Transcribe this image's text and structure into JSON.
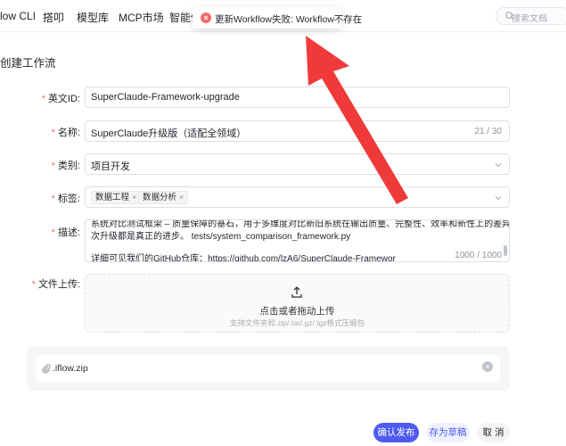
{
  "nav": {
    "items": [
      "low CLI",
      "搭叩",
      "模型库",
      "MCP市场",
      "智能体"
    ],
    "search_placeholder": "搜索文档"
  },
  "toast": {
    "message": "更新Workflow失败: Workflow不存在",
    "icon": "error-circle-icon",
    "color": "#f56c6c"
  },
  "page": {
    "title": "创建工作流"
  },
  "form": {
    "english_id": {
      "label": "英文ID:",
      "value": "SuperClaude-Framework-upgrade"
    },
    "name": {
      "label": "名称:",
      "value": "SuperClaude升级版（适配全领域）",
      "count": "21 / 30"
    },
    "category": {
      "label": "类别:",
      "value": "项目开发"
    },
    "tags": {
      "label": "标签:",
      "items": [
        "数据工程",
        "数据分析"
      ]
    },
    "description": {
      "label": "描述:",
      "line_cut": "系统对比测试框架 – 质量保障的基石，用于多维度对比新旧系统在输出质量、完整性、效率和新性上的差异，确保每",
      "line1": "次升级都是真正的进步。      tests/system_comparison_framework.py",
      "line2": "详细可见我们的GitHub仓库：https://github.com/lzA6/SuperClaude-Framewor",
      "count": "1000 / 1000"
    },
    "upload": {
      "label": "文件上传:",
      "main": "点击或者拖动上传",
      "sub": "支持文件夹和.zip/.tar/.gz/.tgz格式压缩包"
    },
    "file": {
      "name": ".iflow.zip"
    }
  },
  "buttons": {
    "confirm": "确认发布",
    "draft": "存为草稿",
    "cancel": "取 消"
  },
  "colors": {
    "primary": "#4e5bf0",
    "required": "#f56c6c",
    "annotation_arrow": "#f03a3a"
  }
}
